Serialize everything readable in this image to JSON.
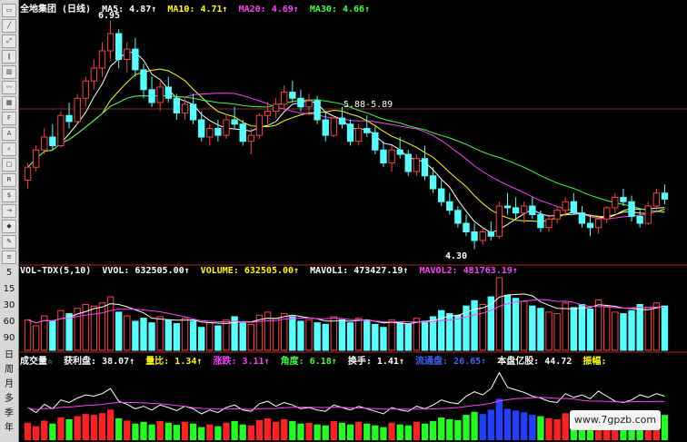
{
  "window": {
    "stock_name": "全地集团",
    "period": "(日线)"
  },
  "colors": {
    "up": "#ff4040",
    "down": "#54ffff",
    "ma5": "#ffffff",
    "ma10": "#ffff00",
    "ma20": "#ff40ff",
    "ma30": "#40ff40",
    "vol_up": "#ff4040",
    "vol_down": "#54ffff",
    "profit_up": "#ff2020",
    "profit_down": "#20ff20",
    "profit_blue": "#2040ff",
    "axis": "#b02020"
  },
  "indicators": {
    "ma5_label": "MA5: 4.87↑",
    "ma10_label": "MA10: 4.71↑",
    "ma20_label": "MA20: 4.69↑",
    "ma30_label": "MA30: 4.66↑",
    "high_label": "6.95",
    "low_label": "4.30",
    "range_label": "5.88-5.89"
  },
  "volume_panel": {
    "title": "VOL-TDX(5,10)",
    "vvol": "VVOL: 632505.00↑",
    "volume": "VOLUME: 632505.00↑",
    "mavol1": "MAVOL1: 473427.19↑",
    "mavol2": "MAVOL2: 481763.19↑",
    "scale": [
      "5",
      "15",
      "30",
      "60",
      "90",
      "日",
      "周",
      "月",
      "多",
      "季",
      "年"
    ]
  },
  "bottom_panel": {
    "label1": "成交量☆",
    "label2": "获利盘: 38.07↑",
    "label3": "量比: 1.34↑",
    "label4": "涨跌: 3.11↑",
    "label5": "角度: 6.18↑",
    "label6": "换手: 1.41↑",
    "label7": "流通盘: 26.65↑",
    "label8": "本盘亿股: 44.72",
    "label9": "振幅:"
  },
  "watermark": "www.7gpzb.com",
  "chart_data": {
    "type": "candlestick",
    "candles": [
      [
        5.1,
        5.3,
        5.0,
        5.25
      ],
      [
        5.25,
        5.5,
        5.2,
        5.45
      ],
      [
        5.45,
        5.7,
        5.4,
        5.6
      ],
      [
        5.6,
        5.75,
        5.45,
        5.5
      ],
      [
        5.5,
        5.9,
        5.48,
        5.85
      ],
      [
        5.85,
        6.0,
        5.7,
        5.78
      ],
      [
        5.78,
        6.1,
        5.75,
        6.05
      ],
      [
        6.05,
        6.3,
        5.95,
        6.25
      ],
      [
        6.25,
        6.5,
        6.15,
        6.4
      ],
      [
        6.4,
        6.7,
        6.3,
        6.6
      ],
      [
        6.6,
        6.95,
        6.5,
        6.8
      ],
      [
        6.8,
        6.85,
        6.4,
        6.5
      ],
      [
        6.5,
        6.7,
        6.35,
        6.62
      ],
      [
        6.62,
        6.75,
        6.3,
        6.38
      ],
      [
        6.38,
        6.45,
        6.05,
        6.15
      ],
      [
        6.15,
        6.3,
        5.95,
        6.0
      ],
      [
        6.0,
        6.25,
        5.9,
        6.18
      ],
      [
        6.18,
        6.3,
        6.0,
        6.05
      ],
      [
        6.05,
        6.1,
        5.8,
        5.88
      ],
      [
        5.88,
        6.05,
        5.8,
        5.98
      ],
      [
        5.98,
        6.1,
        5.75,
        5.8
      ],
      [
        5.8,
        5.9,
        5.55,
        5.6
      ],
      [
        5.6,
        5.75,
        5.5,
        5.7
      ],
      [
        5.7,
        5.8,
        5.55,
        5.62
      ],
      [
        5.62,
        5.85,
        5.58,
        5.8
      ],
      [
        5.8,
        5.95,
        5.7,
        5.75
      ],
      [
        5.75,
        5.8,
        5.5,
        5.55
      ],
      [
        5.55,
        5.7,
        5.4,
        5.62
      ],
      [
        5.62,
        5.88,
        5.58,
        5.85
      ],
      [
        5.85,
        6.0,
        5.75,
        5.9
      ],
      [
        5.9,
        6.05,
        5.82,
        5.98
      ],
      [
        5.98,
        6.2,
        5.92,
        6.12
      ],
      [
        6.12,
        6.25,
        6.0,
        6.05
      ],
      [
        6.05,
        6.15,
        5.9,
        5.95
      ],
      [
        5.95,
        6.1,
        5.85,
        6.02
      ],
      [
        6.02,
        6.08,
        5.75,
        5.8
      ],
      [
        5.8,
        5.9,
        5.55,
        5.62
      ],
      [
        5.62,
        5.85,
        5.6,
        5.82
      ],
      [
        5.82,
        5.95,
        5.7,
        5.75
      ],
      [
        5.75,
        5.8,
        5.5,
        5.55
      ],
      [
        5.55,
        5.75,
        5.5,
        5.7
      ],
      [
        5.7,
        5.85,
        5.6,
        5.65
      ],
      [
        5.65,
        5.72,
        5.4,
        5.45
      ],
      [
        5.45,
        5.55,
        5.25,
        5.3
      ],
      [
        5.3,
        5.5,
        5.2,
        5.45
      ],
      [
        5.45,
        5.6,
        5.35,
        5.4
      ],
      [
        5.4,
        5.45,
        5.15,
        5.2
      ],
      [
        5.2,
        5.4,
        5.15,
        5.35
      ],
      [
        5.35,
        5.5,
        5.1,
        5.15
      ],
      [
        5.15,
        5.25,
        4.95,
        5.0
      ],
      [
        5.0,
        5.1,
        4.8,
        4.85
      ],
      [
        4.85,
        4.95,
        4.7,
        4.75
      ],
      [
        4.75,
        4.8,
        4.55,
        4.6
      ],
      [
        4.6,
        4.7,
        4.45,
        4.5
      ],
      [
        4.5,
        4.6,
        4.3,
        4.4
      ],
      [
        4.4,
        4.55,
        4.35,
        4.5
      ],
      [
        4.5,
        4.62,
        4.4,
        4.45
      ],
      [
        4.45,
        4.85,
        4.42,
        4.8
      ],
      [
        4.8,
        4.95,
        4.7,
        4.78
      ],
      [
        4.78,
        4.9,
        4.65,
        4.72
      ],
      [
        4.72,
        4.85,
        4.6,
        4.8
      ],
      [
        4.8,
        4.9,
        4.65,
        4.7
      ],
      [
        4.7,
        4.75,
        4.5,
        4.55
      ],
      [
        4.55,
        4.7,
        4.5,
        4.65
      ],
      [
        4.65,
        4.8,
        4.6,
        4.75
      ],
      [
        4.75,
        4.9,
        4.68,
        4.85
      ],
      [
        4.85,
        4.95,
        4.7,
        4.72
      ],
      [
        4.72,
        4.8,
        4.55,
        4.6
      ],
      [
        4.6,
        4.7,
        4.45,
        4.55
      ],
      [
        4.55,
        4.68,
        4.48,
        4.65
      ],
      [
        4.65,
        4.8,
        4.6,
        4.78
      ],
      [
        4.78,
        4.95,
        4.72,
        4.9
      ],
      [
        4.9,
        5.0,
        4.8,
        4.85
      ],
      [
        4.85,
        4.92,
        4.62,
        4.68
      ],
      [
        4.68,
        4.75,
        4.55,
        4.6
      ],
      [
        4.6,
        4.85,
        4.58,
        4.8
      ],
      [
        4.8,
        5.0,
        4.75,
        4.95
      ],
      [
        4.95,
        5.05,
        4.82,
        4.88
      ]
    ],
    "volume": [
      40,
      32,
      45,
      38,
      52,
      48,
      55,
      60,
      58,
      62,
      70,
      50,
      45,
      38,
      42,
      36,
      44,
      40,
      35,
      42,
      38,
      30,
      36,
      32,
      40,
      44,
      36,
      34,
      46,
      50,
      42,
      48,
      44,
      38,
      40,
      36,
      34,
      44,
      40,
      36,
      42,
      38,
      34,
      30,
      40,
      36,
      34,
      42,
      38,
      44,
      52,
      48,
      46,
      58,
      65,
      60,
      70,
      95,
      72,
      68,
      64,
      58,
      55,
      50,
      48,
      62,
      56,
      60,
      54,
      66,
      58,
      50,
      48,
      52,
      60,
      56,
      62,
      58
    ]
  }
}
